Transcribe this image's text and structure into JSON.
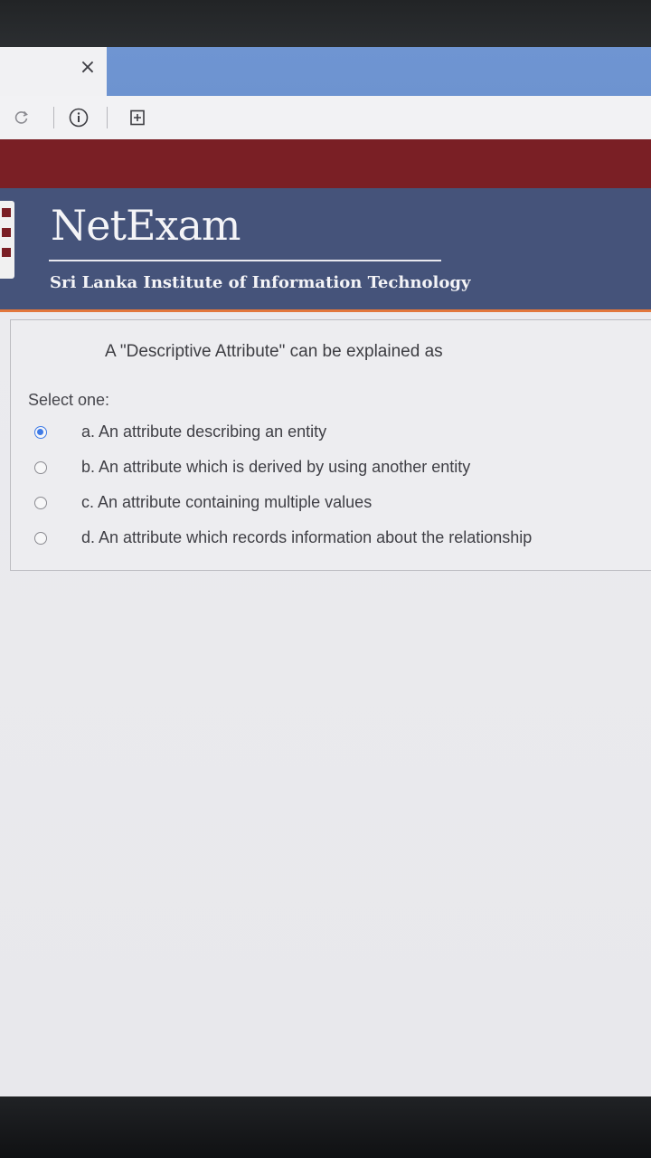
{
  "browser": {
    "tab_close": "×",
    "toolbar": {
      "reload_icon": "reload-icon",
      "info_icon": "info-icon",
      "bookmark_icon": "bookmark-add-icon"
    }
  },
  "header": {
    "title": "NetExam",
    "institute": "Sri Lanka Institute of Information Technology"
  },
  "question": {
    "text": "A \"Descriptive Attribute\" can be explained as",
    "select_label": "Select one:",
    "options": [
      {
        "label": "a. An attribute describing an entity",
        "selected": true
      },
      {
        "label": "b. An attribute which is derived by using another entity",
        "selected": false
      },
      {
        "label": "c. An attribute containing multiple values",
        "selected": false
      },
      {
        "label": "d. An attribute which records information about the relationship",
        "selected": false
      }
    ]
  },
  "colors": {
    "brand_red": "#7a1f25",
    "header_blue": "#45537a",
    "accent_orange": "#e2773c",
    "tab_blue": "#6f95d2",
    "radio_selected": "#3f7be6"
  }
}
